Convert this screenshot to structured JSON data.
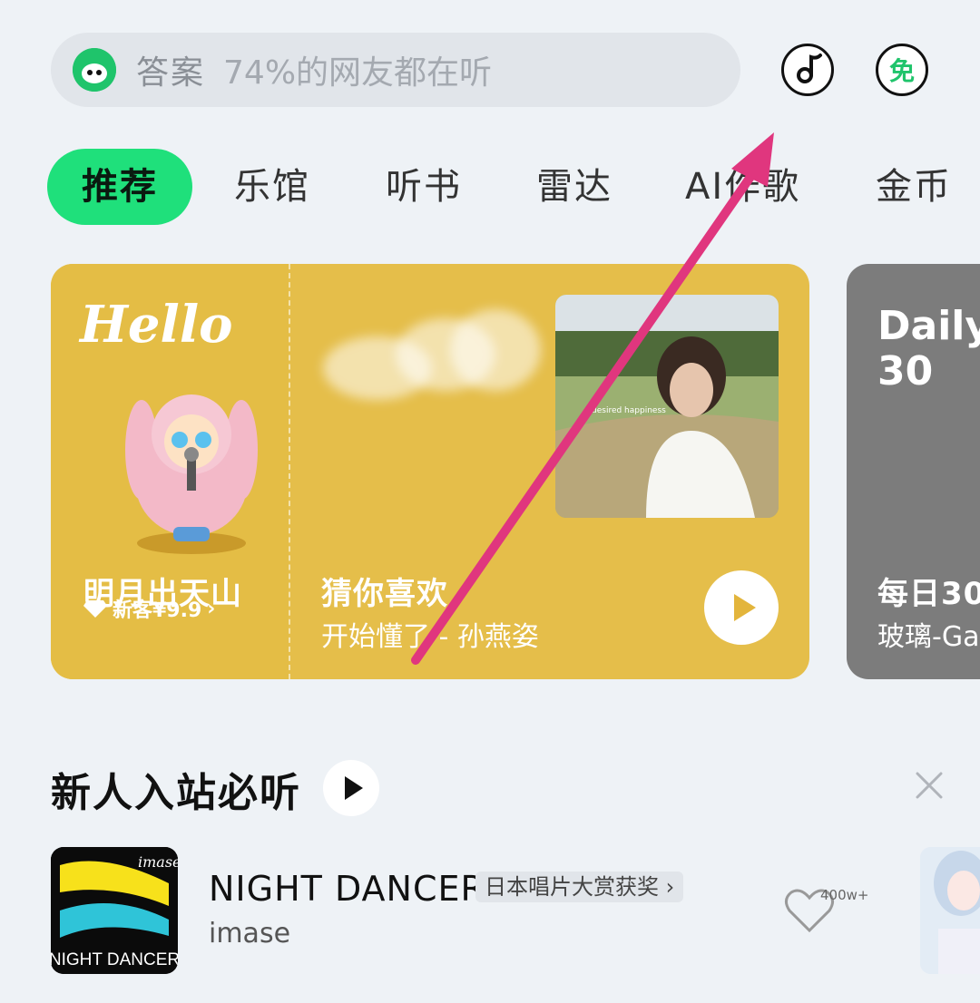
{
  "search": {
    "keyword": "答案",
    "hint": "74%的网友都在听"
  },
  "top_icons": {
    "free_label": "免"
  },
  "tabs": [
    {
      "label": "推荐"
    },
    {
      "label": "乐馆"
    },
    {
      "label": "听书"
    },
    {
      "label": "雷达"
    },
    {
      "label": "AI作歌"
    },
    {
      "label": "金币"
    }
  ],
  "cards": {
    "promo": {
      "hello": "Hello",
      "title": "明月出天山",
      "vip_text": "新客¥9.9"
    },
    "guess": {
      "title": "猜你喜欢",
      "subtitle": "开始懂了 - 孙燕姿",
      "album_caption": "desired happiness"
    },
    "daily": {
      "line1": "Daily",
      "line2": "30",
      "title": "每日30",
      "subtitle": "玻璃-Ga"
    }
  },
  "section": {
    "title": "新人入站必听"
  },
  "song": {
    "name": "NIGHT DANCER",
    "tag": "日本唱片大赏获奖",
    "artist": "imase",
    "cover_text": "NIGHT DANCER",
    "cover_logo": "imase",
    "likes": "400w+"
  },
  "colors": {
    "accent": "#1fe07b",
    "brand": "#1fc46b",
    "card": "#e5be4a",
    "annotation": "#e0367e"
  }
}
